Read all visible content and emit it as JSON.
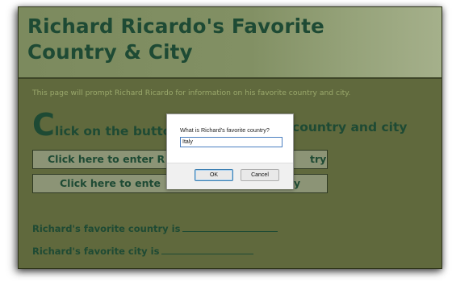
{
  "header": {
    "title_line1": "Richard Ricardo's Favorite",
    "title_line2": "Country & City"
  },
  "intro": "This page will prompt Richard Ricardo for information on his favorite country and city.",
  "headline": {
    "big_letter": "C",
    "rest": "lick on the butto",
    "hidden_tail": "country and city"
  },
  "buttons": {
    "country_visible_start": "Click here to enter R",
    "country_visible_end": "try",
    "city_visible_start": "Click here to ente",
    "city_visible_end": "y"
  },
  "results": {
    "country_label": "Richard's favorite country is",
    "city_label": "Richard's favorite city is"
  },
  "dialog": {
    "message": "What is Richard's favorite country?",
    "input_value": "Italy",
    "ok_label": "OK",
    "cancel_label": "Cancel"
  }
}
